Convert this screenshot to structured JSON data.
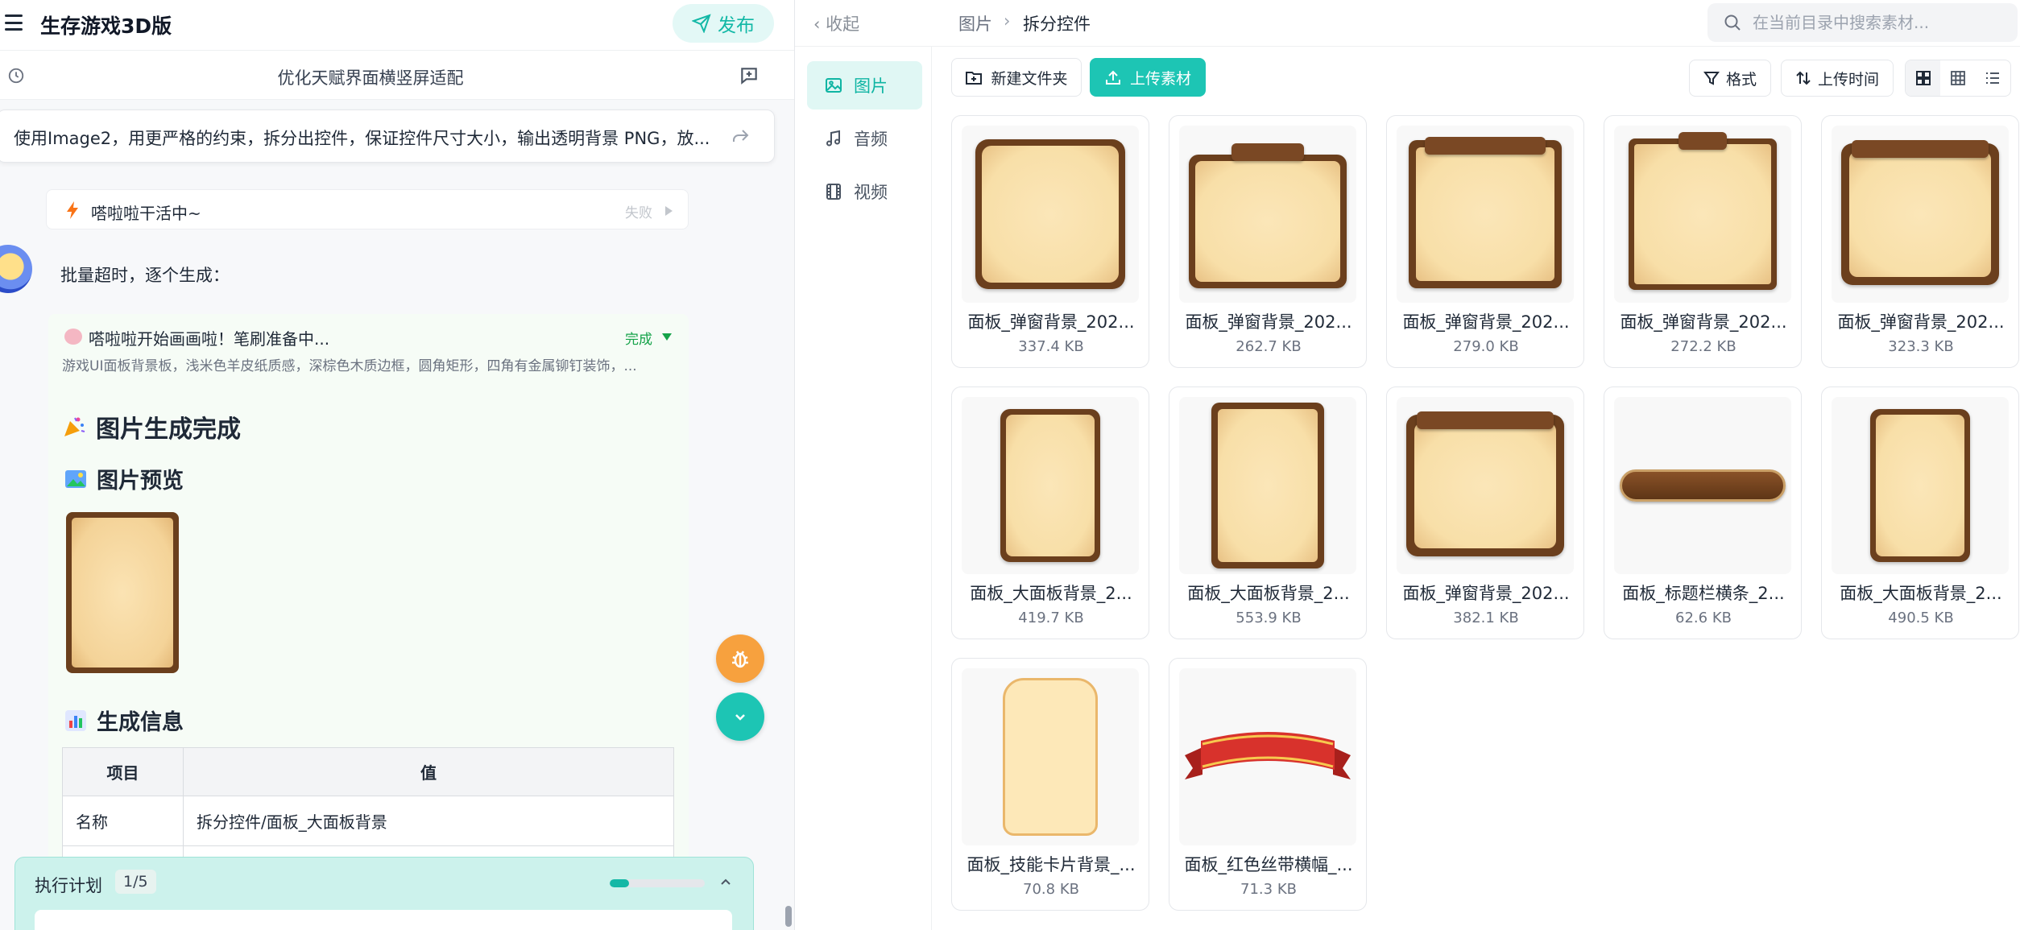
{
  "app": {
    "title": "生存游戏3D版",
    "publish_label": "发布"
  },
  "subbar": {
    "title": "优化天赋界面横竖屏适配"
  },
  "command": {
    "text": "使用Image2，用更严格的约束，拆分出控件，保证控件尺寸大小，输出透明背景 PNG，放..."
  },
  "status": {
    "text": "嗒啦啦干活中~",
    "fail_label": "失败"
  },
  "chat": {
    "batch_text": "批量超时，逐个生成："
  },
  "gen": {
    "title": "嗒啦啦开始画画啦！笔刷准备中...",
    "done_label": "完成",
    "desc": "游戏UI面板背景板，浅米色羊皮纸质感，深棕色木质边框，圆角矩形，四角有金属铆钉装饰，...",
    "heading_done": "图片生成完成",
    "heading_preview": "图片预览",
    "heading_info": "生成信息",
    "table": {
      "headers": [
        "项目",
        "值"
      ],
      "rows": [
        [
          "名称",
          "拆分控件/面板_大面板背景"
        ],
        [
          "",
          ""
        ]
      ]
    }
  },
  "plan": {
    "title": "执行计划",
    "count": "1/5",
    "progress": 0.2
  },
  "right": {
    "collapse_label": "收起",
    "breadcrumb": [
      "图片",
      "拆分控件"
    ],
    "breadcrumb_sep": "›",
    "search_placeholder": "在当前目录中搜索素材...",
    "nav": [
      {
        "label": "图片",
        "icon": "image-icon",
        "active": true
      },
      {
        "label": "音频",
        "icon": "music-icon",
        "active": false
      },
      {
        "label": "视频",
        "icon": "film-icon",
        "active": false
      }
    ],
    "toolbar": {
      "new_folder": "新建文件夹",
      "upload": "上传素材",
      "format": "格式",
      "sort": "上传时间"
    },
    "files": [
      {
        "name": "面板_弹窗背景_202...",
        "size": "337.4 KB",
        "art": "panel-square"
      },
      {
        "name": "面板_弹窗背景_202...",
        "size": "262.7 KB",
        "art": "panel-header"
      },
      {
        "name": "面板_弹窗背景_202...",
        "size": "279.0 KB",
        "art": "panel-topbar"
      },
      {
        "name": "面板_弹窗背景_202...",
        "size": "272.2 KB",
        "art": "panel-tab"
      },
      {
        "name": "面板_弹窗背景_202...",
        "size": "323.3 KB",
        "art": "panel-wide"
      },
      {
        "name": "面板_大面板背景_2...",
        "size": "419.7 KB",
        "art": "panel-tall"
      },
      {
        "name": "面板_大面板背景_2...",
        "size": "553.9 KB",
        "art": "panel-tall2"
      },
      {
        "name": "面板_弹窗背景_202...",
        "size": "382.1 KB",
        "art": "panel-wide"
      },
      {
        "name": "面板_标题栏横条_2...",
        "size": "62.6 KB",
        "art": "title-bar"
      },
      {
        "name": "面板_大面板背景_2...",
        "size": "490.5 KB",
        "art": "panel-tall"
      },
      {
        "name": "面板_技能卡片背景_...",
        "size": "70.8 KB",
        "art": "skill-card"
      },
      {
        "name": "面板_红色丝带横幅_...",
        "size": "71.3 KB",
        "art": "ribbon"
      }
    ]
  },
  "colors": {
    "accent": "#1dc5b4",
    "accent_text": "#0fb5a3",
    "wood": "#6b3f1d",
    "parchment": "#f8dfa8",
    "ribbon": "#d8322c"
  }
}
